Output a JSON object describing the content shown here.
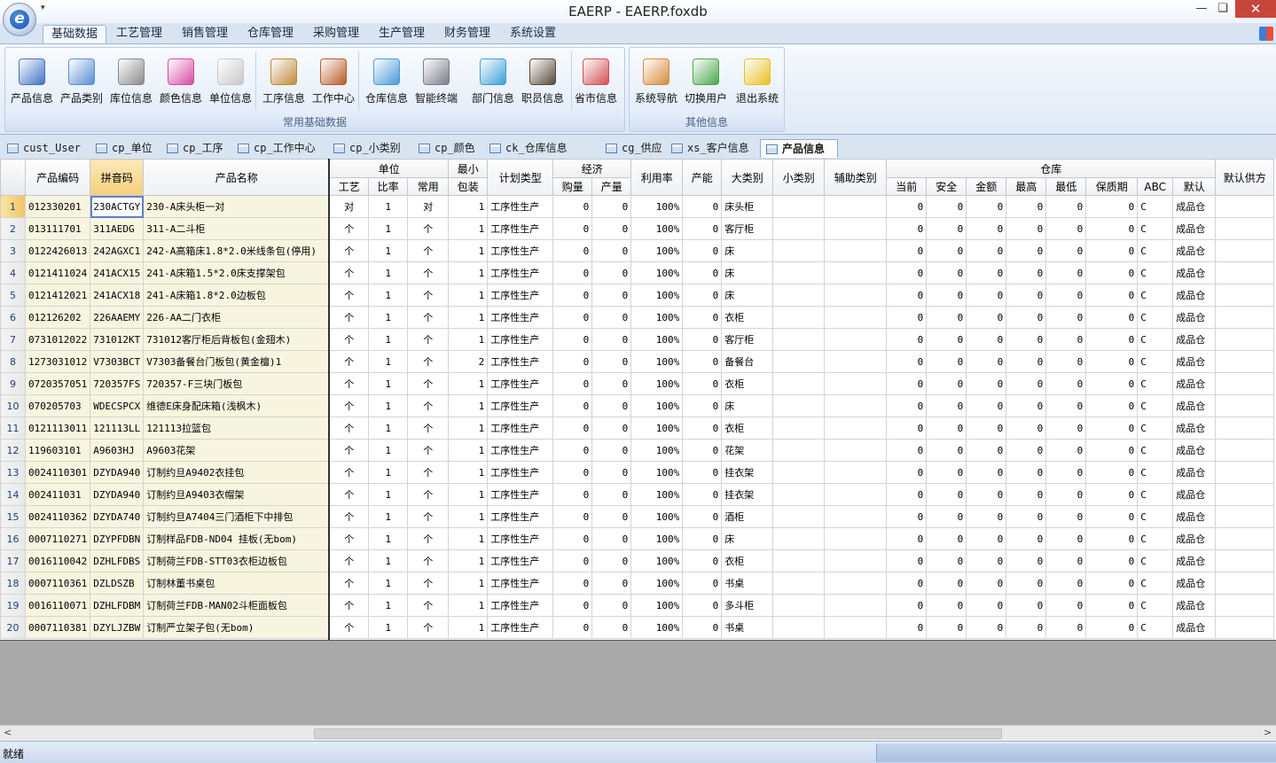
{
  "window": {
    "title": "EAERP - EAERP.foxdb",
    "qat": "▾",
    "min": "—",
    "max": "❏",
    "close": "✕",
    "logo_letter": "e"
  },
  "menu": {
    "tabs": [
      "基础数据",
      "工艺管理",
      "销售管理",
      "仓库管理",
      "采购管理",
      "生产管理",
      "财务管理",
      "系统设置"
    ]
  },
  "ribbon": {
    "group1_label": "常用基础数据",
    "group2_label": "其他信息",
    "buttons1": [
      "产品信息",
      "产品类别",
      "库位信息",
      "颜色信息",
      "单位信息",
      "工序信息",
      "工作中心",
      "仓库信息",
      "智能终端",
      "部门信息",
      "职员信息",
      "省市信息"
    ],
    "buttons2": [
      "系统导航",
      "切换用户",
      "退出系统"
    ]
  },
  "doc_tabs": [
    "cust_User",
    "cp_单位",
    "cp_工序",
    "cp_工作中心",
    "cp_小类别",
    "cp_颜色",
    "ck_仓库信息",
    "cg_供应商",
    "xs_客户信息",
    "产品信息"
  ],
  "grid": {
    "header_top": {
      "code": "产品编码",
      "pinyin": "拼音码",
      "name": "产品名称",
      "unit": "单位",
      "minpack_a": "最小",
      "plan": "计划类型",
      "econ": "经济",
      "profit": "利用率",
      "capacity": "产能",
      "major": "大类别",
      "minor": "小类别",
      "aux": "辅助类别",
      "warehouse": "仓库",
      "supplier": "默认供方"
    },
    "header_sub": {
      "craft": "工艺",
      "ratio": "比率",
      "common": "常用",
      "minpack_b": "包装",
      "buy": "购量",
      "produce": "产量",
      "current": "当前",
      "safe": "安全",
      "amount": "金额",
      "max": "最高",
      "min": "最低",
      "shelf": "保质期",
      "abc": "ABC",
      "default": "默认"
    },
    "rows": [
      [
        "1",
        "012330201",
        "230ACTGY",
        "230-A床头柜一对",
        "对",
        "1",
        "对",
        "1",
        "工序性生产",
        "0",
        "0",
        "100%",
        "0",
        "床头柜",
        "",
        "",
        "0",
        "0",
        "0",
        "0",
        "0",
        "0",
        "C",
        "成品仓",
        ""
      ],
      [
        "2",
        "013111701",
        "311AEDG",
        "311-A二斗柜",
        "个",
        "1",
        "个",
        "1",
        "工序性生产",
        "0",
        "0",
        "100%",
        "0",
        "客厅柜",
        "",
        "",
        "0",
        "0",
        "0",
        "0",
        "0",
        "0",
        "C",
        "成品仓",
        ""
      ],
      [
        "3",
        "0122426013",
        "242AGXC1",
        "242-A高箱床1.8*2.0米线条包(停用)",
        "个",
        "1",
        "个",
        "1",
        "工序性生产",
        "0",
        "0",
        "100%",
        "0",
        "床",
        "",
        "",
        "0",
        "0",
        "0",
        "0",
        "0",
        "0",
        "C",
        "成品仓",
        ""
      ],
      [
        "4",
        "0121411024",
        "241ACX15",
        "241-A床箱1.5*2.0床支撑架包",
        "个",
        "1",
        "个",
        "1",
        "工序性生产",
        "0",
        "0",
        "100%",
        "0",
        "床",
        "",
        "",
        "0",
        "0",
        "0",
        "0",
        "0",
        "0",
        "C",
        "成品仓",
        ""
      ],
      [
        "5",
        "0121412021",
        "241ACX18",
        "241-A床箱1.8*2.0边板包",
        "个",
        "1",
        "个",
        "1",
        "工序性生产",
        "0",
        "0",
        "100%",
        "0",
        "床",
        "",
        "",
        "0",
        "0",
        "0",
        "0",
        "0",
        "0",
        "C",
        "成品仓",
        ""
      ],
      [
        "6",
        "012126202",
        "226AAEMY",
        "226-AA二门衣柜",
        "个",
        "1",
        "个",
        "1",
        "工序性生产",
        "0",
        "0",
        "100%",
        "0",
        "衣柜",
        "",
        "",
        "0",
        "0",
        "0",
        "0",
        "0",
        "0",
        "C",
        "成品仓",
        ""
      ],
      [
        "7",
        "0731012022",
        "731012KT",
        "731012客厅柜后背板包(金翅木)",
        "个",
        "1",
        "个",
        "1",
        "工序性生产",
        "0",
        "0",
        "100%",
        "0",
        "客厅柜",
        "",
        "",
        "0",
        "0",
        "0",
        "0",
        "0",
        "0",
        "C",
        "成品仓",
        ""
      ],
      [
        "8",
        "1273031012",
        "V7303BCT",
        "V7303备餐台门板包(黄金檀)1",
        "个",
        "1",
        "个",
        "2",
        "工序性生产",
        "0",
        "0",
        "100%",
        "0",
        "备餐台",
        "",
        "",
        "0",
        "0",
        "0",
        "0",
        "0",
        "0",
        "C",
        "成品仓",
        ""
      ],
      [
        "9",
        "0720357051",
        "720357FS",
        "720357-F三块门板包",
        "个",
        "1",
        "个",
        "1",
        "工序性生产",
        "0",
        "0",
        "100%",
        "0",
        "衣柜",
        "",
        "",
        "0",
        "0",
        "0",
        "0",
        "0",
        "0",
        "C",
        "成品仓",
        ""
      ],
      [
        "10",
        "070205703",
        "WDECSPCX",
        "维德E床身配床箱(浅枫木)",
        "个",
        "1",
        "个",
        "1",
        "工序性生产",
        "0",
        "0",
        "100%",
        "0",
        "床",
        "",
        "",
        "0",
        "0",
        "0",
        "0",
        "0",
        "0",
        "C",
        "成品仓",
        ""
      ],
      [
        "11",
        "0121113011",
        "121113LL",
        "121113拉篮包",
        "个",
        "1",
        "个",
        "1",
        "工序性生产",
        "0",
        "0",
        "100%",
        "0",
        "衣柜",
        "",
        "",
        "0",
        "0",
        "0",
        "0",
        "0",
        "0",
        "C",
        "成品仓",
        ""
      ],
      [
        "12",
        "119603101",
        "A9603HJ",
        "A9603花架",
        "个",
        "1",
        "个",
        "1",
        "工序性生产",
        "0",
        "0",
        "100%",
        "0",
        "花架",
        "",
        "",
        "0",
        "0",
        "0",
        "0",
        "0",
        "0",
        "C",
        "成品仓",
        ""
      ],
      [
        "13",
        "0024110301",
        "DZYDA940",
        "订制约旦A9402衣挂包",
        "个",
        "1",
        "个",
        "1",
        "工序性生产",
        "0",
        "0",
        "100%",
        "0",
        "挂衣架",
        "",
        "",
        "0",
        "0",
        "0",
        "0",
        "0",
        "0",
        "C",
        "成品仓",
        ""
      ],
      [
        "14",
        "002411031",
        "DZYDA940",
        "订制约旦A9403衣帽架",
        "个",
        "1",
        "个",
        "1",
        "工序性生产",
        "0",
        "0",
        "100%",
        "0",
        "挂衣架",
        "",
        "",
        "0",
        "0",
        "0",
        "0",
        "0",
        "0",
        "C",
        "成品仓",
        ""
      ],
      [
        "15",
        "0024110362",
        "DZYDA740",
        "订制约旦A7404三门酒柜下中排包",
        "个",
        "1",
        "个",
        "1",
        "工序性生产",
        "0",
        "0",
        "100%",
        "0",
        "酒柜",
        "",
        "",
        "0",
        "0",
        "0",
        "0",
        "0",
        "0",
        "C",
        "成品仓",
        ""
      ],
      [
        "16",
        "0007110271",
        "DZYPFDBN",
        "订制样品FDB-ND04  挂板(无bom)",
        "个",
        "1",
        "个",
        "1",
        "工序性生产",
        "0",
        "0",
        "100%",
        "0",
        "床",
        "",
        "",
        "0",
        "0",
        "0",
        "0",
        "0",
        "0",
        "C",
        "成品仓",
        ""
      ],
      [
        "17",
        "0016110042",
        "DZHLFDBS",
        "订制荷兰FDB-STT03衣柜边板包",
        "个",
        "1",
        "个",
        "1",
        "工序性生产",
        "0",
        "0",
        "100%",
        "0",
        "衣柜",
        "",
        "",
        "0",
        "0",
        "0",
        "0",
        "0",
        "0",
        "C",
        "成品仓",
        ""
      ],
      [
        "18",
        "0007110361",
        "DZLDSZB",
        "订制林董书桌包",
        "个",
        "1",
        "个",
        "1",
        "工序性生产",
        "0",
        "0",
        "100%",
        "0",
        "书桌",
        "",
        "",
        "0",
        "0",
        "0",
        "0",
        "0",
        "0",
        "C",
        "成品仓",
        ""
      ],
      [
        "19",
        "0016110071",
        "DZHLFDBM",
        "订制荷兰FDB-MAN02斗柜面板包",
        "个",
        "1",
        "个",
        "1",
        "工序性生产",
        "0",
        "0",
        "100%",
        "0",
        "多斗柜",
        "",
        "",
        "0",
        "0",
        "0",
        "0",
        "0",
        "0",
        "C",
        "成品仓",
        ""
      ],
      [
        "20",
        "0007110381",
        "DZYLJZBW",
        "订制严立架子包(无bom)",
        "个",
        "1",
        "个",
        "1",
        "工序性生产",
        "0",
        "0",
        "100%",
        "0",
        "书桌",
        "",
        "",
        "0",
        "0",
        "0",
        "0",
        "0",
        "0",
        "C",
        "成品仓",
        ""
      ]
    ]
  },
  "scroll": {
    "left_arrow": "<",
    "right_arrow": ">"
  },
  "status": {
    "text": "就绪"
  },
  "colors": {
    "accent": "#5a82c0",
    "frozen_bg": "#f7f5df",
    "selected_header": "#f5cf7a",
    "close": "#c7463a"
  }
}
